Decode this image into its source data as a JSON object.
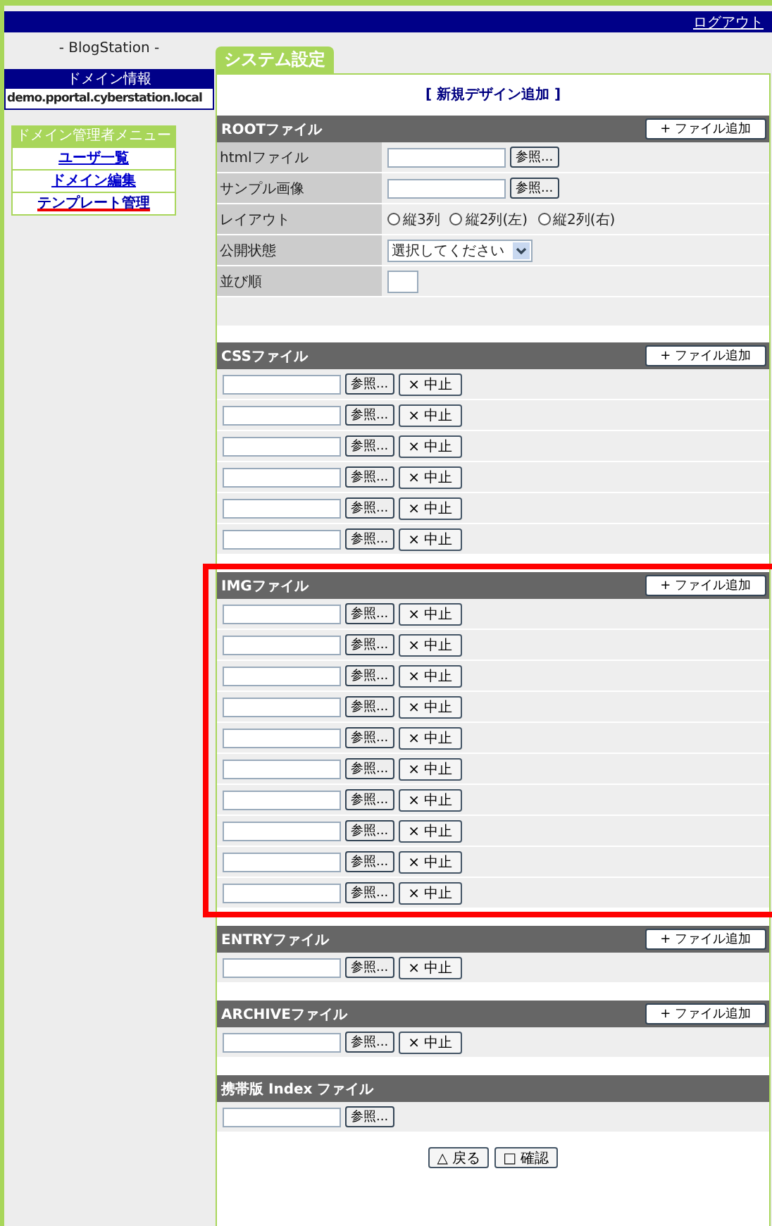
{
  "top_bar": {
    "logout": "ログアウト"
  },
  "sidebar": {
    "site_name": "- BlogStation -",
    "domain_info": {
      "title": "ドメイン情報",
      "value": "demo.pportal.cyberstation.local"
    },
    "menu": {
      "title": "ドメイン管理者メニュー",
      "items": [
        {
          "label": "ユーザ一覧",
          "selected": false
        },
        {
          "label": "ドメイン編集",
          "selected": false
        },
        {
          "label": "テンプレート管理",
          "selected": true
        }
      ]
    }
  },
  "main": {
    "tab": "システム設定",
    "heading": "[ 新規デザイン追加 ]",
    "sections": [
      {
        "kind": "form",
        "title": "ROOTファイル",
        "add_button": "+ ファイル追加",
        "highlighted": false,
        "fields": [
          {
            "kind": "file",
            "label": "htmlファイル",
            "browse": "参照..."
          },
          {
            "kind": "file",
            "label": "サンプル画像",
            "browse": "参照..."
          },
          {
            "kind": "radio",
            "label": "レイアウト",
            "options": [
              {
                "label": "縦3列",
                "selected": false
              },
              {
                "label": "縦2列(左)",
                "selected": false
              },
              {
                "label": "縦2列(右)",
                "selected": false
              }
            ]
          },
          {
            "kind": "select",
            "label": "公開状態",
            "value": "選択してください"
          },
          {
            "kind": "text",
            "label": "並び順"
          }
        ]
      },
      {
        "kind": "files",
        "title": "CSSファイル",
        "add_button": "+ ファイル追加",
        "highlighted": false,
        "rows": [
          {
            "browse": "参照...",
            "cancel": "× 中止"
          },
          {
            "browse": "参照...",
            "cancel": "× 中止"
          },
          {
            "browse": "参照...",
            "cancel": "× 中止"
          },
          {
            "browse": "参照...",
            "cancel": "× 中止"
          },
          {
            "browse": "参照...",
            "cancel": "× 中止"
          },
          {
            "browse": "参照...",
            "cancel": "× 中止"
          }
        ]
      },
      {
        "kind": "files",
        "title": "IMGファイル",
        "add_button": "+ ファイル追加",
        "highlighted": true,
        "rows": [
          {
            "browse": "参照...",
            "cancel": "× 中止"
          },
          {
            "browse": "参照...",
            "cancel": "× 中止"
          },
          {
            "browse": "参照...",
            "cancel": "× 中止"
          },
          {
            "browse": "参照...",
            "cancel": "× 中止"
          },
          {
            "browse": "参照...",
            "cancel": "× 中止"
          },
          {
            "browse": "参照...",
            "cancel": "× 中止"
          },
          {
            "browse": "参照...",
            "cancel": "× 中止"
          },
          {
            "browse": "参照...",
            "cancel": "× 中止"
          },
          {
            "browse": "参照...",
            "cancel": "× 中止"
          },
          {
            "browse": "参照...",
            "cancel": "× 中止"
          }
        ]
      },
      {
        "kind": "files",
        "title": "ENTRYファイル",
        "add_button": "+ ファイル追加",
        "highlighted": false,
        "rows": [
          {
            "browse": "参照...",
            "cancel": "× 中止"
          }
        ]
      },
      {
        "kind": "files",
        "title": "ARCHIVEファイル",
        "add_button": "+ ファイル追加",
        "highlighted": false,
        "rows": [
          {
            "browse": "参照...",
            "cancel": "× 中止"
          }
        ]
      },
      {
        "kind": "files",
        "title": "携帯版 Index ファイル",
        "highlighted": false,
        "rows": [
          {
            "browse": "参照..."
          }
        ]
      }
    ],
    "buttons": [
      "△ 戻る",
      "□ 確認"
    ]
  }
}
